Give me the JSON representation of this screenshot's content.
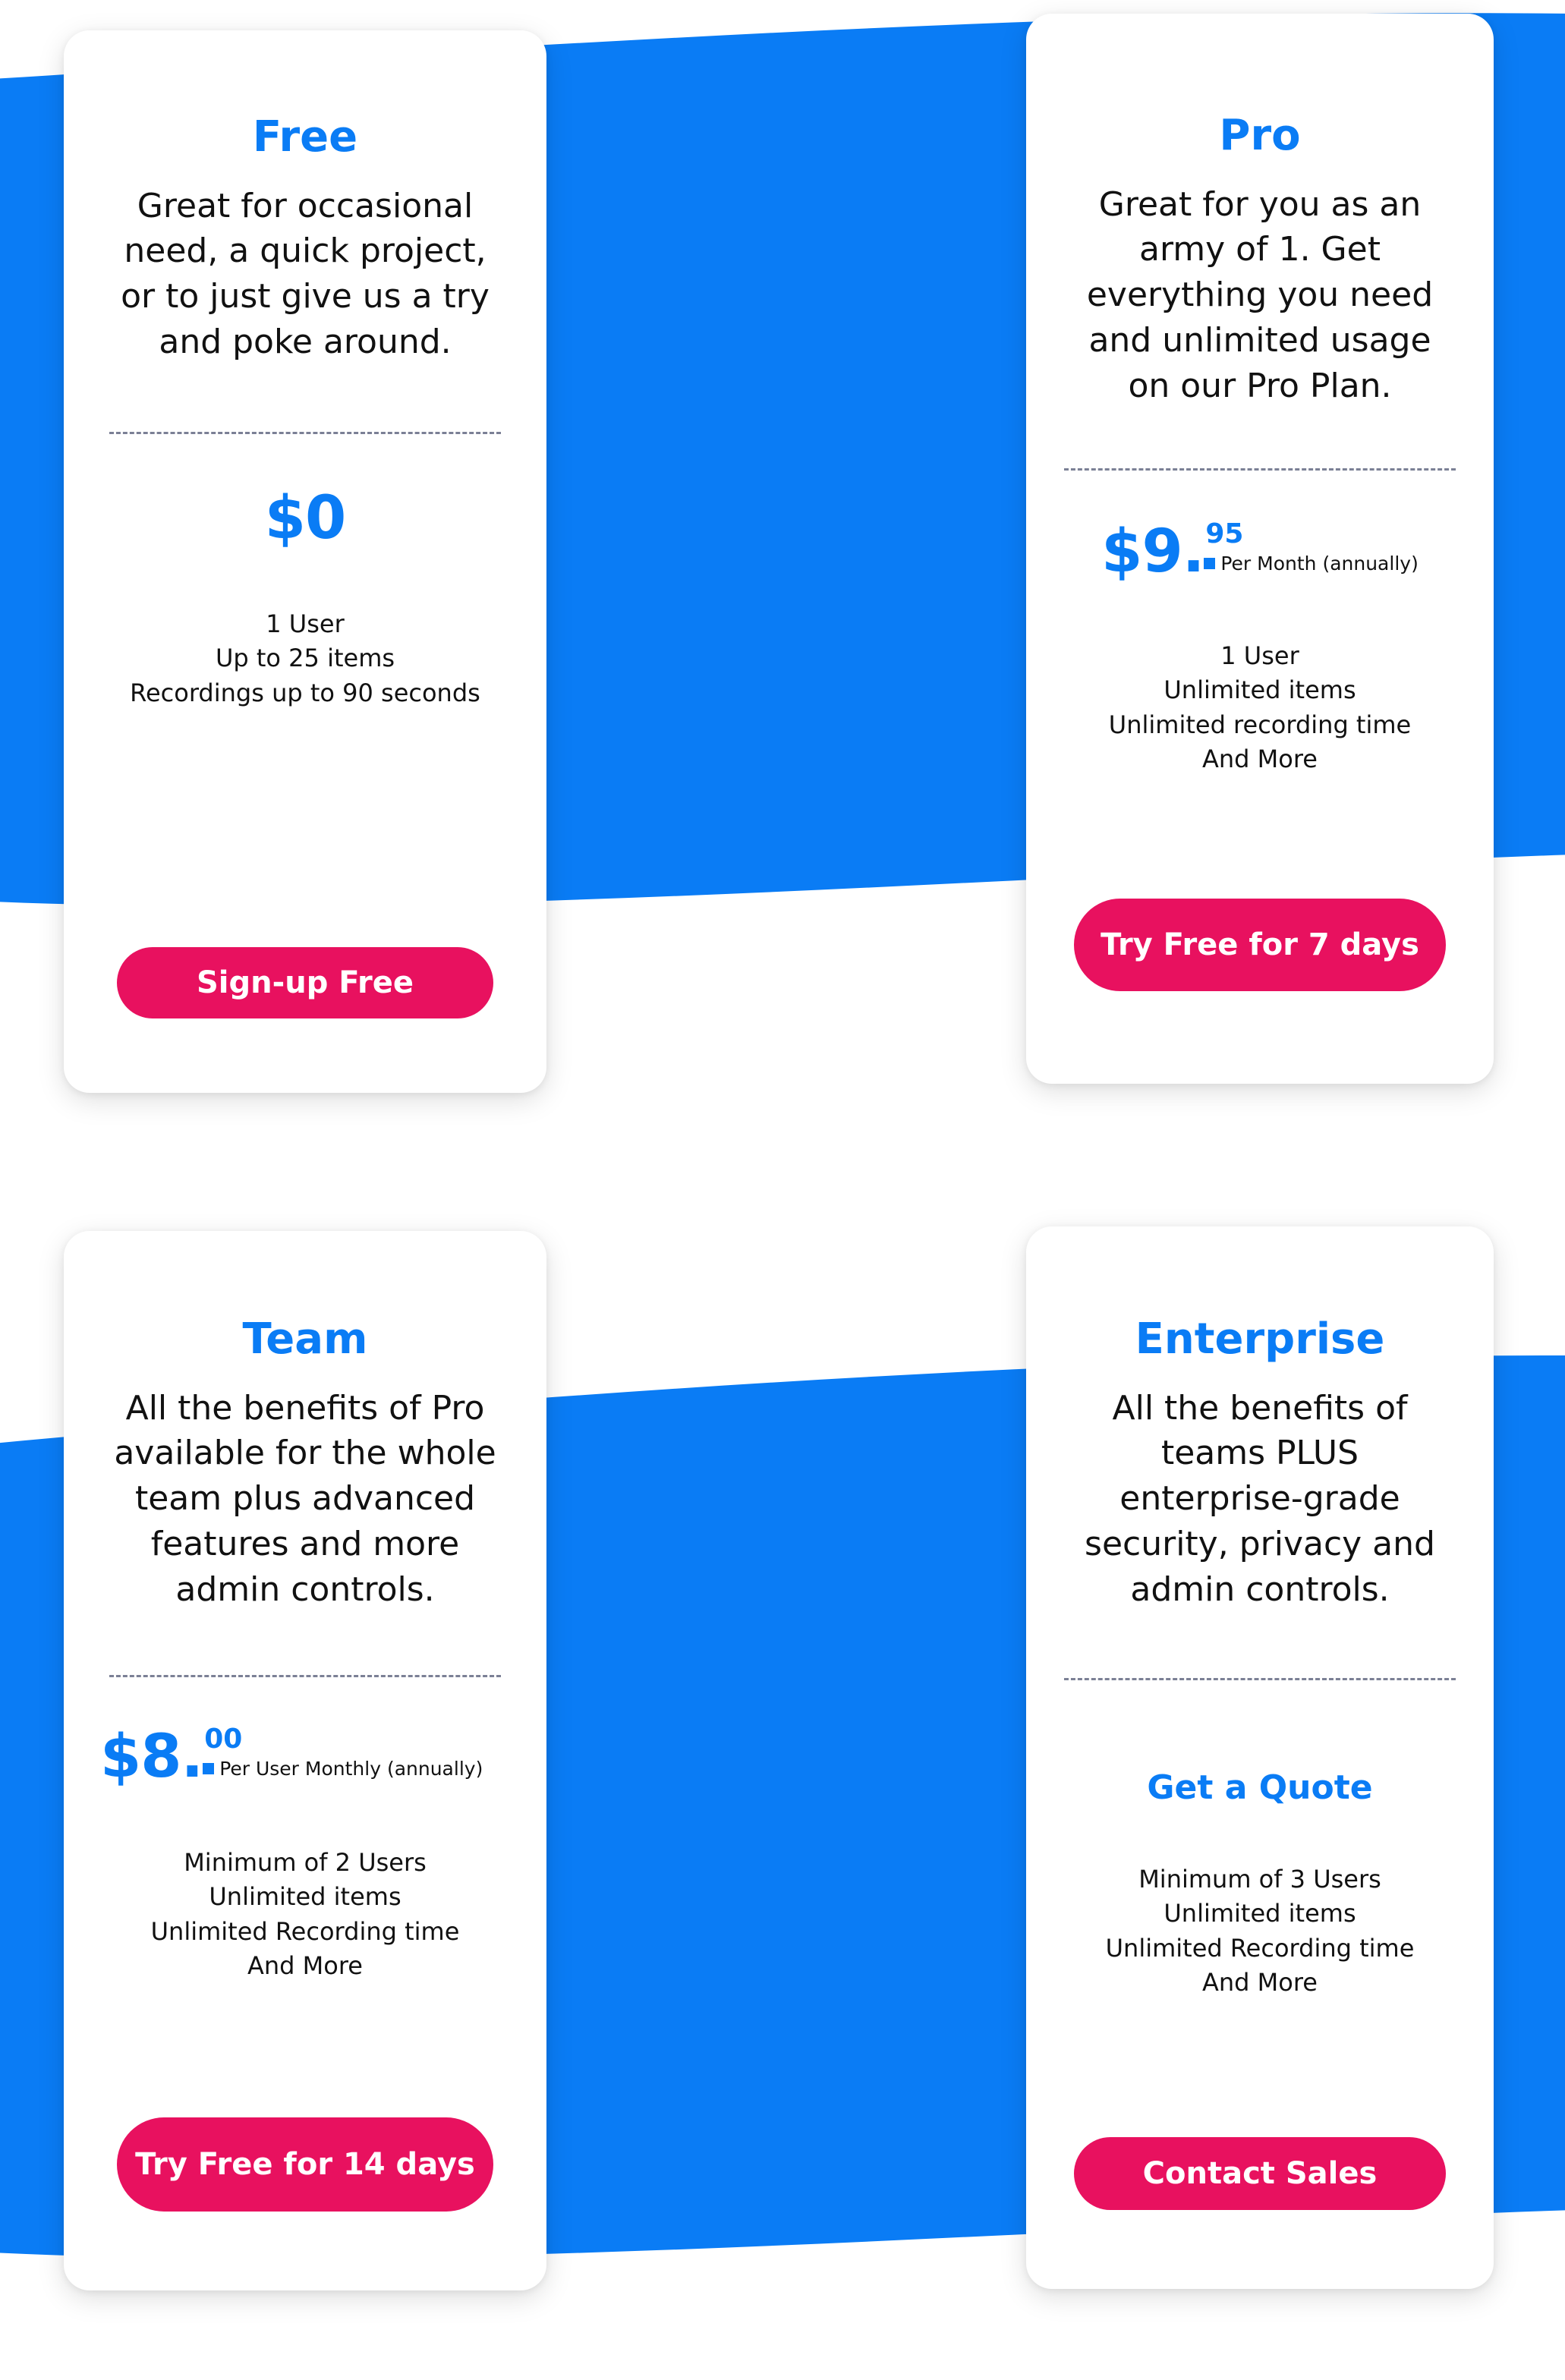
{
  "theme": {
    "accent_blue": "#0a7cf5",
    "button_pink": "#e8115f",
    "background": "#ffffff",
    "wave_blue": "#0a7cf5",
    "divider_gray": "#7b8095",
    "text_dark": "#111111"
  },
  "plans": [
    {
      "id": "free",
      "name": "Free",
      "description": "Great for occasional need, a quick project, or to just give us a try and poke around.",
      "price_main": "$0",
      "price_cents": "",
      "price_period": "",
      "features": [
        "1 User",
        "Up to 25 items",
        "Recordings up to 90 seconds"
      ],
      "cta_label": "Sign-up Free"
    },
    {
      "id": "pro",
      "name": "Pro",
      "description": "Great for you as an army of 1. Get everything you need and unlimited usage on our Pro Plan.",
      "price_main": "$9.",
      "price_cents": "95",
      "price_period": "Per Month (annually)",
      "features": [
        "1 User",
        "Unlimited items",
        "Unlimited recording time",
        "And More"
      ],
      "cta_label": "Try Free for 7 days"
    },
    {
      "id": "team",
      "name": "Team",
      "description": "All the benefits of Pro available for the whole team plus advanced features and more admin controls.",
      "price_main": "$8.",
      "price_cents": "00",
      "price_period": "Per User Monthly (annually)",
      "features": [
        "Minimum of 2 Users",
        "Unlimited items",
        "Unlimited Recording time",
        "And More"
      ],
      "cta_label": "Try Free for 14 days"
    },
    {
      "id": "enterprise",
      "name": "Enterprise",
      "description": "All the benefits of teams PLUS enterprise-grade security, privacy and admin controls.",
      "quote_label": "Get a Quote",
      "features": [
        "Minimum of 3 Users",
        "Unlimited items",
        "Unlimited Recording time",
        "And More"
      ],
      "cta_label": "Contact Sales"
    }
  ]
}
